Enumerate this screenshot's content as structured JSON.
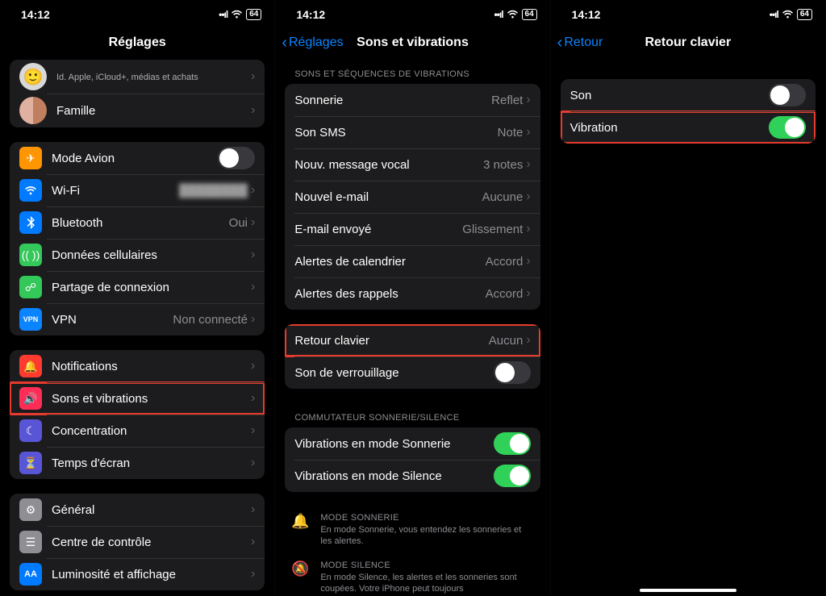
{
  "status": {
    "time": "14:12",
    "battery": "64"
  },
  "panel1": {
    "title": "Réglages",
    "profile": {
      "name": "",
      "sub": "Id. Apple, iCloud+, médias et achats"
    },
    "family": "Famille",
    "rows": {
      "airplane": "Mode Avion",
      "wifi": "Wi-Fi",
      "wifi_value": " ",
      "bluetooth": "Bluetooth",
      "bluetooth_value": "Oui",
      "cellular": "Données cellulaires",
      "hotspot": "Partage de connexion",
      "vpn": "VPN",
      "vpn_value": "Non connecté",
      "notifications": "Notifications",
      "sounds": "Sons et vibrations",
      "focus": "Concentration",
      "screentime": "Temps d'écran",
      "general": "Général",
      "control": "Centre de contrôle",
      "brightness": "Luminosité et affichage"
    }
  },
  "panel2": {
    "back": "Réglages",
    "title": "Sons et vibrations",
    "header1": "SONS ET SÉQUENCES DE VIBRATIONS",
    "rows": {
      "ringtone": "Sonnerie",
      "ringtone_v": "Reflet",
      "sms": "Son SMS",
      "sms_v": "Note",
      "voicemail": "Nouv. message vocal",
      "voicemail_v": "3 notes",
      "email": "Nouvel e-mail",
      "email_v": "Aucune",
      "sent": "E-mail envoyé",
      "sent_v": "Glissement",
      "calendar": "Alertes de calendrier",
      "calendar_v": "Accord",
      "reminders": "Alertes des rappels",
      "reminders_v": "Accord",
      "keyboard": "Retour clavier",
      "keyboard_v": "Aucun",
      "lock": "Son de verrouillage"
    },
    "header2": "COMMUTATEUR SONNERIE/SILENCE",
    "rows2": {
      "vib_ring": "Vibrations en mode Sonnerie",
      "vib_silent": "Vibrations en mode Silence"
    },
    "info1": {
      "title": "MODE SONNERIE",
      "desc": "En mode Sonnerie, vous entendez les sonneries et les alertes."
    },
    "info2": {
      "title": "MODE SILENCE",
      "desc": "En mode Silence, les alertes et les sonneries sont coupées. Votre iPhone peut toujours"
    }
  },
  "panel3": {
    "back": "Retour",
    "title": "Retour clavier",
    "rows": {
      "son": "Son",
      "vibration": "Vibration"
    }
  }
}
